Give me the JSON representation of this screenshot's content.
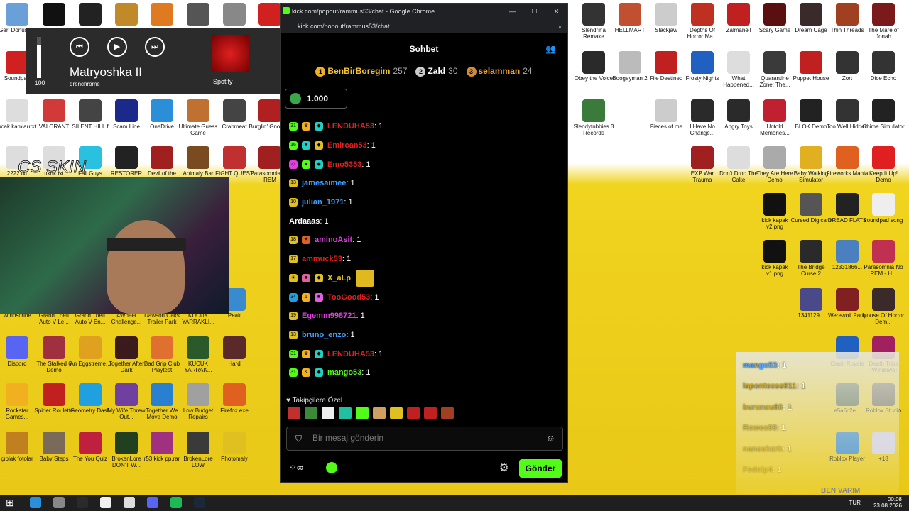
{
  "desktop": {
    "icons_left": [
      {
        "label": "Geri Dönüşüm",
        "color": "#6aa0d8"
      },
      {
        "label": "",
        "color": "#111"
      },
      {
        "label": "",
        "color": "#222"
      },
      {
        "label": "",
        "color": "#c08a2a"
      },
      {
        "label": "",
        "color": "#e07a20"
      },
      {
        "label": "",
        "color": "#555"
      },
      {
        "label": "",
        "color": "#888"
      },
      {
        "label": "",
        "color": "#d02020"
      },
      {
        "label": "Soundpad",
        "color": "#d02020"
      },
      {
        "label": "pcak kamlarıtxt",
        "color": "#ddd"
      },
      {
        "label": "VALORANT",
        "color": "#d23a3a"
      },
      {
        "label": "SILENT HILL f",
        "color": "#444"
      },
      {
        "label": "Scam Line",
        "color": "#1b2a8a"
      },
      {
        "label": "OneDrive",
        "color": "#2a8fd8"
      },
      {
        "label": "Ultimate Guess Game",
        "color": "#c07030"
      },
      {
        "label": "Crabmeat",
        "color": "#444"
      },
      {
        "label": "Burglin' Gnomes",
        "color": "#b02020"
      },
      {
        "label": "2222.txt",
        "color": "#ddd"
      },
      {
        "label": "tıktık.txt",
        "color": "#ddd"
      },
      {
        "label": "Fall Guys",
        "color": "#2ac0e0"
      },
      {
        "label": "RESTORER",
        "color": "#222"
      },
      {
        "label": "Devil of the Plague",
        "color": "#a02020"
      },
      {
        "label": "Animaly Bar",
        "color": "#7a4a20"
      },
      {
        "label": "FIGHT QUEST",
        "color": "#c03030"
      },
      {
        "label": "Parasomnia No REM",
        "color": "#a02020"
      },
      {
        "label": "Windscribe",
        "color": "#2a2a5a"
      },
      {
        "label": "Grand Theft Auto V Le...",
        "color": "#3a6a3a"
      },
      {
        "label": "Grand Theft Auto V En...",
        "color": "#3a6a3a"
      },
      {
        "label": "4Wheel Challenge...",
        "color": "#5a5a2a"
      },
      {
        "label": "Dawson Oaks Trailer Park",
        "color": "#4a3a2a"
      },
      {
        "label": "KUCUK YARRAKLI...",
        "color": "#2a5a2a"
      },
      {
        "label": "Peak",
        "color": "#3a8ad0"
      },
      {
        "label": "Discord",
        "color": "#5865f2"
      },
      {
        "label": "The Stalked 6 Demo",
        "color": "#a03040"
      },
      {
        "label": "An Eggstreme...",
        "color": "#e0a020"
      },
      {
        "label": "Together After Dark",
        "color": "#3a1a1a"
      },
      {
        "label": "Bad Grip Club Playtest",
        "color": "#e07030"
      },
      {
        "label": "KUCUK YARRAK...",
        "color": "#2a5a2a"
      },
      {
        "label": "Hard",
        "color": "#5a2a2a"
      },
      {
        "label": "Rockstar Games...",
        "color": "#f0b020"
      },
      {
        "label": "Spider Roulette",
        "color": "#c02020"
      },
      {
        "label": "Geometry Dash",
        "color": "#20a0e0"
      },
      {
        "label": "My Wife Threw Out...",
        "color": "#7040a0"
      },
      {
        "label": "Together We Move Demo",
        "color": "#2a80d0"
      },
      {
        "label": "Low Budget Repairs",
        "color": "#a0a0a0"
      },
      {
        "label": "Firefox.exe",
        "color": "#e06020"
      },
      {
        "label": "çıplak fotolar",
        "color": "#c08020"
      },
      {
        "label": "Baby Steps",
        "color": "#7a6a5a"
      },
      {
        "label": "The You Quiz",
        "color": "#c02040"
      },
      {
        "label": "BrokenLore DON'T W...",
        "color": "#204020"
      },
      {
        "label": "r53 kick pp.rar",
        "color": "#a03080"
      },
      {
        "label": "BrokenLore LOW",
        "color": "#3a3a3a"
      },
      {
        "label": "Photomaly",
        "color": "#e0c020"
      }
    ],
    "icons_right": [
      {
        "label": "Slendrina Remake",
        "color": "#333"
      },
      {
        "label": "HELLMART",
        "color": "#c05030"
      },
      {
        "label": "Slackjaw",
        "color": "#ccc"
      },
      {
        "label": "Depths Of Horror Ma...",
        "color": "#c03020"
      },
      {
        "label": "Zalmanell",
        "color": "#c02020"
      },
      {
        "label": "Scary Game",
        "color": "#5a1010"
      },
      {
        "label": "Dream Cage",
        "color": "#3a2a2a"
      },
      {
        "label": "Thin Threads",
        "color": "#a04020"
      },
      {
        "label": "The Mare of Jonah",
        "color": "#7a1a1a"
      },
      {
        "label": "Obey the Voice",
        "color": "#2a2a2a"
      },
      {
        "label": "Boogeyman 2",
        "color": "#bbb"
      },
      {
        "label": "File Destined",
        "color": "#c02020"
      },
      {
        "label": "Frosty Nights",
        "color": "#2060c0"
      },
      {
        "label": "What Happened...",
        "color": "#ddd"
      },
      {
        "label": "Quarantine Zone: The...",
        "color": "#3a3a3a"
      },
      {
        "label": "Puppet House",
        "color": "#c02020"
      },
      {
        "label": "Zort",
        "color": "#333"
      },
      {
        "label": "Dice Echo",
        "color": "#333"
      },
      {
        "label": "Slendytubbies 3 Records",
        "color": "#3a7a3a"
      },
      {
        "label": "Pieces of me",
        "color": "#ccc"
      },
      {
        "label": "I Have No Change...",
        "color": "#2a2a2a"
      },
      {
        "label": "Angry Toys",
        "color": "#2a2a2a"
      },
      {
        "label": "Untold Memories...",
        "color": "#c02030"
      },
      {
        "label": "BLOK Demo",
        "color": "#222"
      },
      {
        "label": "Too Well Hidden",
        "color": "#333"
      },
      {
        "label": "Chime Simulator",
        "color": "#222"
      },
      {
        "label": "EXP War Trauma",
        "color": "#a02020"
      },
      {
        "label": "Don't Drop The Cake",
        "color": "#ddd"
      },
      {
        "label": "They Are Here Demo",
        "color": "#aaa"
      },
      {
        "label": "Baby Walking Simulator",
        "color": "#e0b020"
      },
      {
        "label": "Fireworks Mania",
        "color": "#e06020"
      },
      {
        "label": "Keep It Up! Demo",
        "color": "#e02020"
      },
      {
        "label": "kick kapak v2.png",
        "color": "#111"
      },
      {
        "label": "Cursed Digicam",
        "color": "#555"
      },
      {
        "label": "DREAD FLATS",
        "color": "#222"
      },
      {
        "label": "soundpad song",
        "color": "#eee"
      },
      {
        "label": "kick kapak v1.png",
        "color": "#111"
      },
      {
        "label": "The Bridge Curse 2",
        "color": "#2a2a2a"
      },
      {
        "label": "12331866...",
        "color": "#4a80c0"
      },
      {
        "label": "Parasomnia No REM - H...",
        "color": "#c03050"
      },
      {
        "label": "1341129...",
        "color": "#4a4a8a"
      },
      {
        "label": "Werewolf Party",
        "color": "#802020"
      },
      {
        "label": "House Of Horror Dem...",
        "color": "#3a2a2a"
      },
      {
        "label": "Clash Royale",
        "color": "#2060c0"
      },
      {
        "label": "Death Trips (Windows)",
        "color": "#a02060"
      },
      {
        "label": "e5a5c2e...",
        "color": "#2a4a3a"
      },
      {
        "label": "Roblox Studio",
        "color": "#444"
      },
      {
        "label": "Roblox Player",
        "color": "#2080e0"
      },
      {
        "label": "+18",
        "color": "#d0d0ff"
      }
    ],
    "cs_skin_text": "CS SKIN"
  },
  "media": {
    "volume": 100,
    "volume_label": "100",
    "prev_icon": "prev-icon",
    "play_icon": "play-icon",
    "next_icon": "next-icon",
    "title": "Matryoshka II",
    "artist": "drenchrome",
    "source": "Spotify"
  },
  "chrome": {
    "window_title": "kick.com/popout/rammus53/chat - Google Chrome",
    "url": "kick.com/popout/rammus53/chat",
    "minimize": "—",
    "maximize": "☐",
    "close": "✕"
  },
  "chat": {
    "header": "Sohbet",
    "leaderboard": [
      {
        "rank": "1",
        "name": "BenBirBoregim",
        "count": "257",
        "color": "#f0b020",
        "name_color": "#f0c030"
      },
      {
        "rank": "2",
        "name": "Zald",
        "count": "30",
        "color": "#ccc",
        "name_color": "#ffffff"
      },
      {
        "rank": "3",
        "name": "selamman",
        "count": "24",
        "color": "#d08a3a",
        "name_color": "#f0a030"
      }
    ],
    "gift_amount": "1.000",
    "messages": [
      {
        "badges": [
          {
            "t": "31",
            "c": "#53fc18"
          },
          {
            "t": "♛",
            "c": "#f0b020"
          },
          {
            "t": "◆",
            "c": "#20d0c0"
          }
        ],
        "user": "LENDUHA53",
        "color": "#e02020",
        "text": ": 1"
      },
      {
        "badges": [
          {
            "t": "16",
            "c": "#53fc18"
          },
          {
            "t": "■",
            "c": "#20d0c0"
          },
          {
            "t": "◆",
            "c": "#e0c020"
          }
        ],
        "user": "Emircan53",
        "color": "#e02020",
        "text": ": 1"
      },
      {
        "badges": [
          {
            "t": "◇",
            "c": "#e040e0"
          },
          {
            "t": "■",
            "c": "#53fc18"
          },
          {
            "t": "◆",
            "c": "#20d0c0"
          }
        ],
        "user": "Emo5353",
        "color": "#e02020",
        "text": ": 1"
      },
      {
        "badges": [
          {
            "t": "13",
            "c": "#e0c020"
          }
        ],
        "user": "jamesaimee",
        "color": "#40a0ff",
        "text": ": 1"
      },
      {
        "badges": [
          {
            "t": "10",
            "c": "#e0c020"
          }
        ],
        "user": "julian_1971",
        "color": "#40a0ff",
        "text": ": 1"
      },
      {
        "badges": [],
        "user": "Ardaaas",
        "color": "#ffffff",
        "text": ": 1"
      },
      {
        "badges": [
          {
            "t": "18",
            "c": "#e0c020"
          },
          {
            "t": "✦",
            "c": "#e06020"
          }
        ],
        "user": "aminoAsit",
        "color": "#e040e0",
        "text": ": 1"
      },
      {
        "badges": [
          {
            "t": "17",
            "c": "#e0c020"
          }
        ],
        "user": "ammuck53",
        "color": "#e02020",
        "text": ": 1"
      },
      {
        "badges": [
          {
            "t": "☀",
            "c": "#e0c020"
          },
          {
            "t": "■",
            "c": "#e060a0"
          },
          {
            "t": "◆",
            "c": "#e0c020"
          }
        ],
        "user": "X_aLp",
        "color": "#f0c020",
        "text": ":",
        "emote": true
      },
      {
        "badges": [
          {
            "t": "34",
            "c": "#20a0e0"
          },
          {
            "t": "1",
            "c": "#f0b020"
          },
          {
            "t": "■",
            "c": "#e060e0"
          }
        ],
        "user": "TooGood53",
        "color": "#e02020",
        "text": ": 1"
      },
      {
        "badges": [
          {
            "t": "19",
            "c": "#e0c020"
          }
        ],
        "user": "Egemm998721",
        "color": "#e040e0",
        "text": ": 1"
      },
      {
        "badges": [
          {
            "t": "13",
            "c": "#e0c020"
          }
        ],
        "user": "bruno_enzo",
        "color": "#40a0ff",
        "text": ": 1"
      },
      {
        "badges": [
          {
            "t": "31",
            "c": "#53fc18"
          },
          {
            "t": "♛",
            "c": "#f0b020"
          },
          {
            "t": "◆",
            "c": "#20d0c0"
          }
        ],
        "user": "LENDUHA53",
        "color": "#e02020",
        "text": ": 1"
      },
      {
        "badges": [
          {
            "t": "31",
            "c": "#53fc18"
          },
          {
            "t": "K",
            "c": "#f0b020"
          },
          {
            "t": "◆",
            "c": "#20d0c0"
          }
        ],
        "user": "mango53",
        "color": "#53fc18",
        "text": ": 1"
      }
    ],
    "followers_only": "Takipçilere Özel",
    "emote_colors": [
      "#c03030",
      "#3a8a3a",
      "#eeeeee",
      "#20c0a0",
      "#53fc18",
      "#d0a060",
      "#e0c020",
      "#c02020",
      "#c02020",
      "#a04020"
    ],
    "input_placeholder": "Bir mesaj gönderin",
    "send": "Gönder"
  },
  "overlay": {
    "items": [
      {
        "user": "mango53",
        "text": ": 1"
      },
      {
        "user": "lapontesss911",
        "text": ": 1"
      },
      {
        "user": "buruncu80",
        "text": ": 1"
      },
      {
        "user": "Rowes03",
        "text": ": 1"
      },
      {
        "user": "nanoshark",
        "text": ": 1"
      },
      {
        "user": "Fedelp4",
        "text": ": 1"
      }
    ],
    "ben_varim": "BEN VARIM"
  },
  "taskbar": {
    "lang": "TUR",
    "time": "00:08",
    "date": "23.08.2026",
    "apps": [
      "#2a8fd8",
      "#888",
      "#2a2a2a",
      "#f0f0f0",
      "#ddd",
      "#5865f2",
      "#1db954",
      "#1b2838"
    ]
  }
}
